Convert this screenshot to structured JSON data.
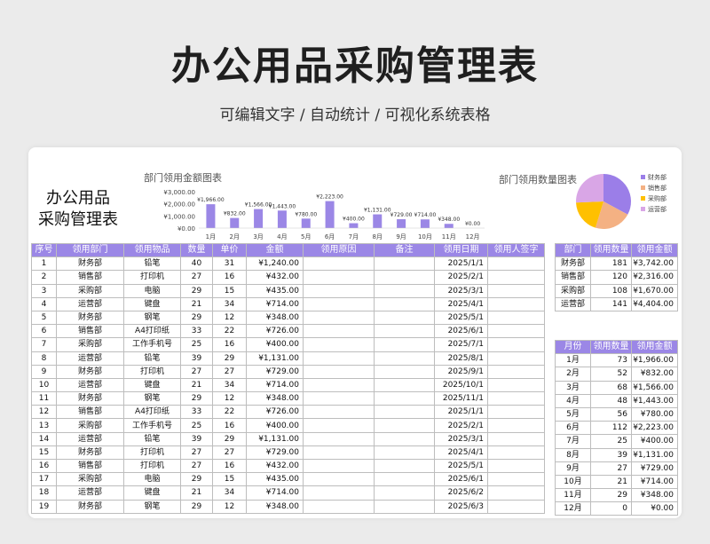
{
  "header": {
    "title": "办公用品采购管理表",
    "subtitle": "可编辑文字 / 自动统计 / 可视化系统表格"
  },
  "sheet": {
    "title_line1": "办公用品",
    "title_line2": "采购管理表"
  },
  "chart_data": [
    {
      "type": "bar",
      "title": "部门领用金额图表",
      "categories": [
        "1月",
        "2月",
        "3月",
        "4月",
        "5月",
        "6月",
        "7月",
        "8月",
        "9月",
        "10月",
        "11月",
        "12月"
      ],
      "values": [
        1966,
        832,
        1566,
        1443,
        780,
        2223,
        400,
        1131,
        729,
        714,
        348,
        0
      ],
      "data_labels": [
        "¥1,966.00",
        "¥832.00",
        "¥1,566.00",
        "¥1,443.00",
        "¥780.00",
        "¥2,223.00",
        "¥400.00",
        "¥1,131.00",
        "¥729.00",
        "¥714.00",
        "¥348.00",
        "¥0.00"
      ],
      "y_ticks": [
        "¥3,000.00",
        "¥2,000.00",
        "¥1,000.00",
        "¥0.00"
      ],
      "ylim": [
        0,
        3000
      ],
      "color": "#9b87e6"
    },
    {
      "type": "pie",
      "title": "部门领用数量图表",
      "labels": [
        "财务部",
        "销售部",
        "采购部",
        "运营部"
      ],
      "values": [
        181,
        120,
        108,
        141
      ],
      "colors": [
        "#9b7ee8",
        "#f4b183",
        "#ffc000",
        "#d9a6e6"
      ],
      "legend": "right"
    }
  ],
  "main_table": {
    "headers": [
      "序号",
      "领用部门",
      "领用物品",
      "数量",
      "单价",
      "金额",
      "领用原因",
      "备注",
      "领用日期",
      "领用人签字"
    ],
    "rows": [
      [
        "1",
        "财务部",
        "铅笔",
        "40",
        "31",
        "¥1,240.00",
        "",
        "",
        "2025/1/1",
        ""
      ],
      [
        "2",
        "销售部",
        "打印机",
        "27",
        "16",
        "¥432.00",
        "",
        "",
        "2025/2/1",
        ""
      ],
      [
        "3",
        "采购部",
        "电脑",
        "29",
        "15",
        "¥435.00",
        "",
        "",
        "2025/3/1",
        ""
      ],
      [
        "4",
        "运营部",
        "键盘",
        "21",
        "34",
        "¥714.00",
        "",
        "",
        "2025/4/1",
        ""
      ],
      [
        "5",
        "财务部",
        "钢笔",
        "29",
        "12",
        "¥348.00",
        "",
        "",
        "2025/5/1",
        ""
      ],
      [
        "6",
        "销售部",
        "A4打印纸",
        "33",
        "22",
        "¥726.00",
        "",
        "",
        "2025/6/1",
        ""
      ],
      [
        "7",
        "采购部",
        "工作手机号",
        "25",
        "16",
        "¥400.00",
        "",
        "",
        "2025/7/1",
        ""
      ],
      [
        "8",
        "运营部",
        "铅笔",
        "39",
        "29",
        "¥1,131.00",
        "",
        "",
        "2025/8/1",
        ""
      ],
      [
        "9",
        "财务部",
        "打印机",
        "27",
        "27",
        "¥729.00",
        "",
        "",
        "2025/9/1",
        ""
      ],
      [
        "10",
        "运营部",
        "键盘",
        "21",
        "34",
        "¥714.00",
        "",
        "",
        "2025/10/1",
        ""
      ],
      [
        "11",
        "财务部",
        "钢笔",
        "29",
        "12",
        "¥348.00",
        "",
        "",
        "2025/11/1",
        ""
      ],
      [
        "12",
        "销售部",
        "A4打印纸",
        "33",
        "22",
        "¥726.00",
        "",
        "",
        "2025/1/1",
        ""
      ],
      [
        "13",
        "采购部",
        "工作手机号",
        "25",
        "16",
        "¥400.00",
        "",
        "",
        "2025/2/1",
        ""
      ],
      [
        "14",
        "运营部",
        "铅笔",
        "39",
        "29",
        "¥1,131.00",
        "",
        "",
        "2025/3/1",
        ""
      ],
      [
        "15",
        "财务部",
        "打印机",
        "27",
        "27",
        "¥729.00",
        "",
        "",
        "2025/4/1",
        ""
      ],
      [
        "16",
        "销售部",
        "打印机",
        "27",
        "16",
        "¥432.00",
        "",
        "",
        "2025/5/1",
        ""
      ],
      [
        "17",
        "采购部",
        "电脑",
        "29",
        "15",
        "¥435.00",
        "",
        "",
        "2025/6/1",
        ""
      ],
      [
        "18",
        "运营部",
        "键盘",
        "21",
        "34",
        "¥714.00",
        "",
        "",
        "2025/6/2",
        ""
      ],
      [
        "19",
        "财务部",
        "钢笔",
        "29",
        "12",
        "¥348.00",
        "",
        "",
        "2025/6/3",
        ""
      ]
    ]
  },
  "dept_table": {
    "headers": [
      "部门",
      "领用数量",
      "领用金额"
    ],
    "rows": [
      [
        "财务部",
        "181",
        "¥3,742.00"
      ],
      [
        "销售部",
        "120",
        "¥2,316.00"
      ],
      [
        "采购部",
        "108",
        "¥1,670.00"
      ],
      [
        "运营部",
        "141",
        "¥4,404.00"
      ]
    ]
  },
  "month_table": {
    "headers": [
      "月份",
      "领用数量",
      "领用金额"
    ],
    "rows": [
      [
        "1月",
        "73",
        "¥1,966.00"
      ],
      [
        "2月",
        "52",
        "¥832.00"
      ],
      [
        "3月",
        "68",
        "¥1,566.00"
      ],
      [
        "4月",
        "48",
        "¥1,443.00"
      ],
      [
        "5月",
        "56",
        "¥780.00"
      ],
      [
        "6月",
        "112",
        "¥2,223.00"
      ],
      [
        "7月",
        "25",
        "¥400.00"
      ],
      [
        "8月",
        "39",
        "¥1,131.00"
      ],
      [
        "9月",
        "27",
        "¥729.00"
      ],
      [
        "10月",
        "21",
        "¥714.00"
      ],
      [
        "11月",
        "29",
        "¥348.00"
      ],
      [
        "12月",
        "0",
        "¥0.00"
      ]
    ]
  }
}
